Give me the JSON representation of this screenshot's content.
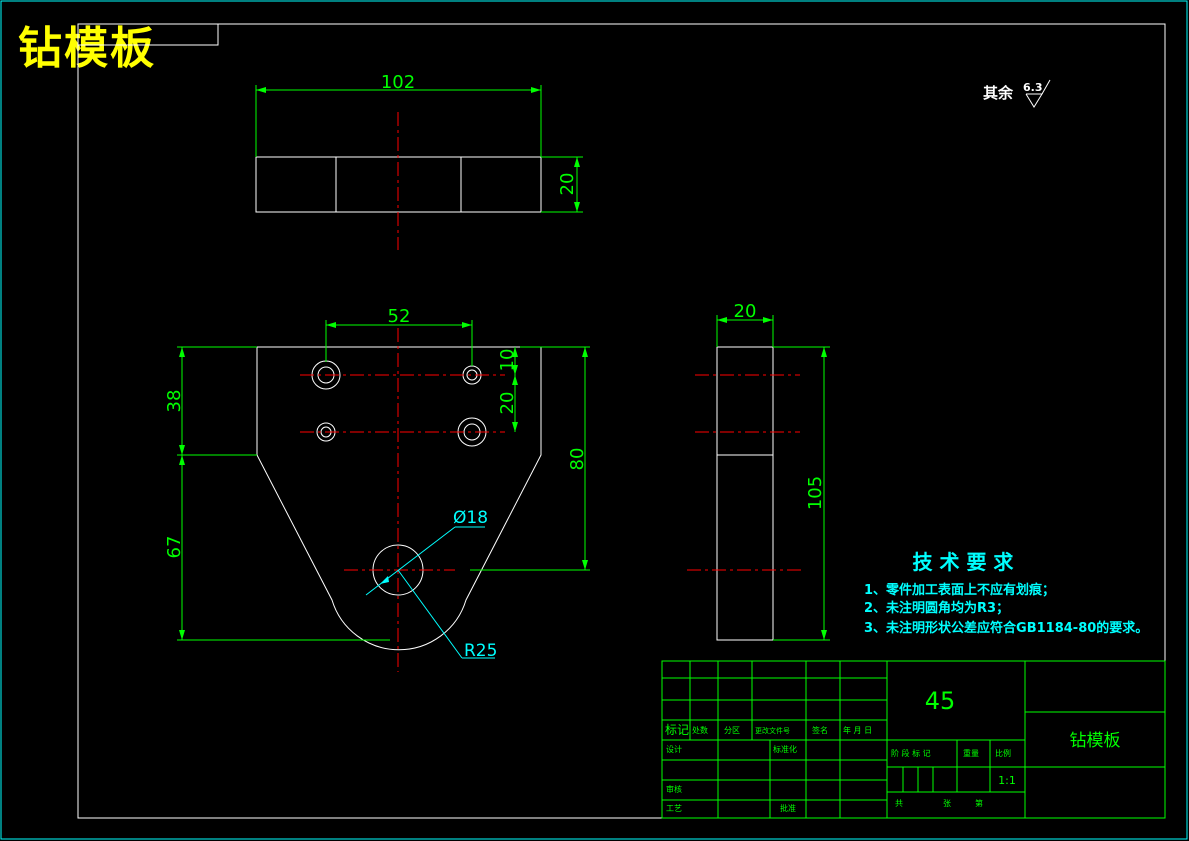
{
  "drawing_title": "钻模板",
  "surface_note": {
    "prefix": "其余",
    "roughness": "6.3"
  },
  "dimensions": {
    "top_width": "102",
    "top_thickness": "20",
    "hole_spacing": "52",
    "hole_offset_top": "10",
    "hole_row_gap": "20",
    "left_upper": "38",
    "left_lower": "67",
    "right_height": "80",
    "diameter": "Ø18",
    "radius": "R25",
    "side_width": "20",
    "side_height": "105"
  },
  "tech_requirements": {
    "heading": "技 术 要 求",
    "items": [
      "1、零件加工表面上不应有划痕；",
      "2、未注明圆角均为R3；",
      "3、未注明形状公差应符合GB1184-80的要求。"
    ]
  },
  "title_block": {
    "material": "45",
    "part_name": "钻模板",
    "scale": "1:1",
    "row_labels": [
      "标记",
      "处数",
      "分区",
      "更改文件号",
      "签名",
      "年 月 日"
    ],
    "design": "设计",
    "standardize": "标准化",
    "review": "审核",
    "process": "工艺",
    "approve": "批准",
    "stage_mark": "阶 段 标 记",
    "weight": "重量",
    "scale_label": "比例",
    "sheet_total": "共",
    "sheet_label": "张",
    "sheet_num": "第"
  },
  "colors": {
    "outline": "#ffffff",
    "dimension": "#00ff00",
    "center": "#ff0000",
    "label": "#00ffff",
    "title": "#ffff00"
  }
}
